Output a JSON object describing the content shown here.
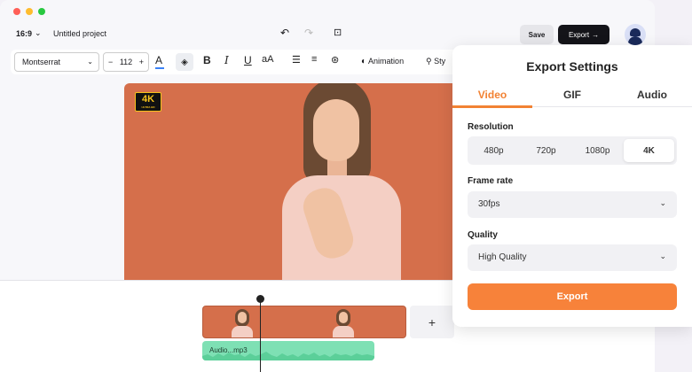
{
  "window": {
    "title": "Untitled project",
    "aspect_ratio": "16:9"
  },
  "topbar": {
    "save_label": "Save",
    "export_label": "Export",
    "export_arrow": "→",
    "undo_icon": "undo-icon",
    "redo_icon": "redo-icon",
    "preview_icon": "preview-icon"
  },
  "toolbar": {
    "font_family": "Montserrat",
    "font_size": "112",
    "minus": "−",
    "plus": "+",
    "bold": "B",
    "italic": "I",
    "underline": "U",
    "case": "aA",
    "animation_label": "Animation",
    "style_label": "Sty"
  },
  "canvas": {
    "badge_4k": "4K",
    "badge_sub": "ULTRA HD"
  },
  "timeline": {
    "audio_label": "Audio...mp3",
    "add_label": "+"
  },
  "export_panel": {
    "title": "Export Settings",
    "tabs": [
      "Video",
      "GIF",
      "Audio"
    ],
    "active_tab": "Video",
    "resolution_label": "Resolution",
    "resolution_options": [
      "480p",
      "720p",
      "1080p",
      "4K"
    ],
    "resolution_selected": "4K",
    "frame_rate_label": "Frame rate",
    "frame_rate_value": "30fps",
    "quality_label": "Quality",
    "quality_value": "High Quality",
    "export_button": "Export"
  },
  "colors": {
    "accent": "#f7823a",
    "video_bg": "#d56f4b",
    "audio_track": "#7ee0b4"
  }
}
